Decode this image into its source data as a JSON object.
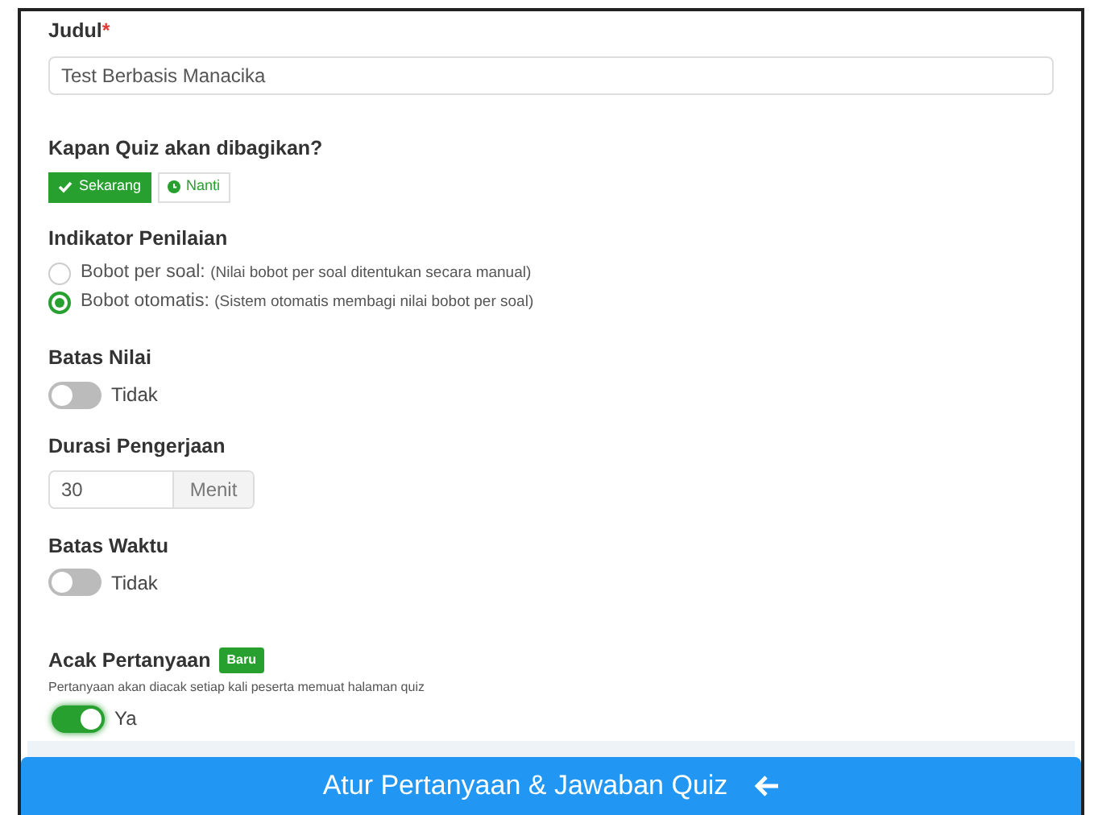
{
  "title_field": {
    "label": "Judul",
    "required_mark": "*",
    "value": "Test Berbasis Manacika"
  },
  "share_time": {
    "label": "Kapan Quiz akan dibagikan?",
    "options": [
      {
        "label": "Sekarang",
        "selected": true
      },
      {
        "label": "Nanti",
        "selected": false
      }
    ]
  },
  "grading": {
    "label": "Indikator Penilaian",
    "options": [
      {
        "label": "Bobot per soal:",
        "note": "(Nilai bobot per soal ditentukan secara manual)",
        "selected": false
      },
      {
        "label": "Bobot otomatis:",
        "note": "(Sistem otomatis membagi nilai bobot per soal)",
        "selected": true
      }
    ]
  },
  "score_limit": {
    "label": "Batas Nilai",
    "on": false,
    "state_label": "Tidak"
  },
  "duration": {
    "label": "Durasi Pengerjaan",
    "value": "30",
    "unit": "Menit"
  },
  "time_limit": {
    "label": "Batas Waktu",
    "on": false,
    "state_label": "Tidak"
  },
  "shuffle": {
    "label": "Acak Pertanyaan",
    "badge": "Baru",
    "description": "Pertanyaan akan diacak setiap kali peserta memuat halaman quiz",
    "on": true,
    "state_label": "Ya"
  },
  "submit_button": {
    "label": "Atur Pertanyaan & Jawaban Quiz"
  }
}
